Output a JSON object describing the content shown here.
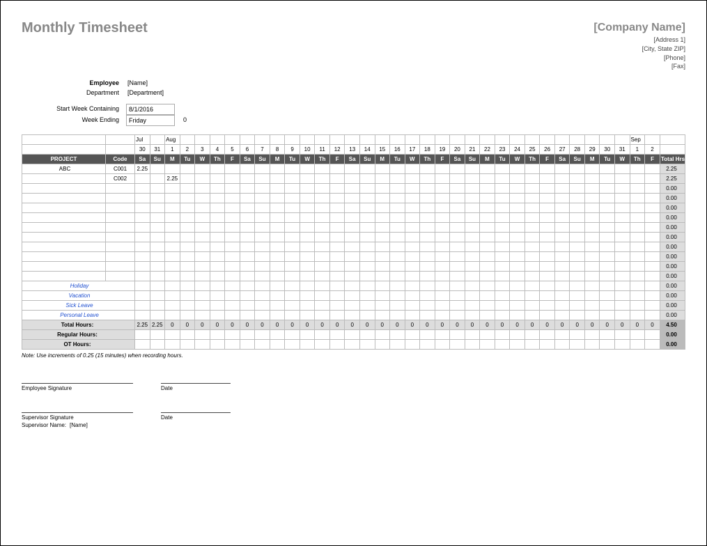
{
  "title": "Monthly Timesheet",
  "company": {
    "name": "[Company Name]",
    "address1": "[Address 1]",
    "address2": "[City, State ZIP]",
    "phone": "[Phone]",
    "fax": "[Fax]"
  },
  "meta": {
    "employee_label": "Employee",
    "employee_value": "[Name]",
    "department_label": "Department",
    "department_value": "[Department]",
    "startweek_label": "Start Week Containing",
    "startweek_value": "8/1/2016",
    "weekending_label": "Week Ending",
    "weekending_value": "Friday",
    "weekending_extra": "0"
  },
  "months": {
    "jul": "Jul",
    "aug": "Aug",
    "sep": "Sep"
  },
  "dates": [
    "30",
    "31",
    "1",
    "2",
    "3",
    "4",
    "5",
    "6",
    "7",
    "8",
    "9",
    "10",
    "11",
    "12",
    "13",
    "14",
    "15",
    "16",
    "17",
    "18",
    "19",
    "20",
    "21",
    "22",
    "23",
    "24",
    "25",
    "26",
    "27",
    "28",
    "29",
    "30",
    "31",
    "1",
    "2"
  ],
  "days": [
    "Sa",
    "Su",
    "M",
    "Tu",
    "W",
    "Th",
    "F",
    "Sa",
    "Su",
    "M",
    "Tu",
    "W",
    "Th",
    "F",
    "Sa",
    "Su",
    "M",
    "Tu",
    "W",
    "Th",
    "F",
    "Sa",
    "Su",
    "M",
    "Tu",
    "W",
    "Th",
    "F",
    "Sa",
    "Su",
    "M",
    "Tu",
    "W",
    "Th",
    "F"
  ],
  "header": {
    "project": "PROJECT",
    "code": "Code",
    "total": "Total Hrs"
  },
  "rows": [
    {
      "project": "ABC",
      "code": "C001",
      "cells": {
        "0": "2.25"
      },
      "total": "2.25"
    },
    {
      "project": "",
      "code": "C002",
      "cells": {
        "2": "2.25"
      },
      "total": "2.25"
    },
    {
      "project": "",
      "code": "",
      "cells": {},
      "total": "0.00"
    },
    {
      "project": "",
      "code": "",
      "cells": {},
      "total": "0.00"
    },
    {
      "project": "",
      "code": "",
      "cells": {},
      "total": "0.00"
    },
    {
      "project": "",
      "code": "",
      "cells": {},
      "total": "0.00"
    },
    {
      "project": "",
      "code": "",
      "cells": {},
      "total": "0.00"
    },
    {
      "project": "",
      "code": "",
      "cells": {},
      "total": "0.00"
    },
    {
      "project": "",
      "code": "",
      "cells": {},
      "total": "0.00"
    },
    {
      "project": "",
      "code": "",
      "cells": {},
      "total": "0.00"
    },
    {
      "project": "",
      "code": "",
      "cells": {},
      "total": "0.00"
    },
    {
      "project": "",
      "code": "",
      "cells": {},
      "total": "0.00"
    }
  ],
  "leaveRows": [
    {
      "label": "Holiday",
      "total": "0.00"
    },
    {
      "label": "Vacation",
      "total": "0.00"
    },
    {
      "label": "Sick Leave",
      "total": "0.00"
    },
    {
      "label": "Personal Leave",
      "total": "0.00"
    }
  ],
  "totals": {
    "total_hours_label": "Total Hours:",
    "total_hours": [
      "2.25",
      "2.25",
      "0",
      "0",
      "0",
      "0",
      "0",
      "0",
      "0",
      "0",
      "0",
      "0",
      "0",
      "0",
      "0",
      "0",
      "0",
      "0",
      "0",
      "0",
      "0",
      "0",
      "0",
      "0",
      "0",
      "0",
      "0",
      "0",
      "0",
      "0",
      "0",
      "0",
      "0",
      "0",
      "0"
    ],
    "grand_total": "4.50",
    "regular_label": "Regular Hours:",
    "regular_total": "0.00",
    "ot_label": "OT Hours:",
    "ot_total": "0.00"
  },
  "note": "Note: Use increments of 0.25 (15 minutes) when recording hours.",
  "signatures": {
    "emp_sig": "Employee Signature",
    "sup_sig": "Supervisor Signature",
    "date": "Date",
    "sup_name_label": "Supervisor Name:",
    "sup_name_value": "[Name]"
  }
}
